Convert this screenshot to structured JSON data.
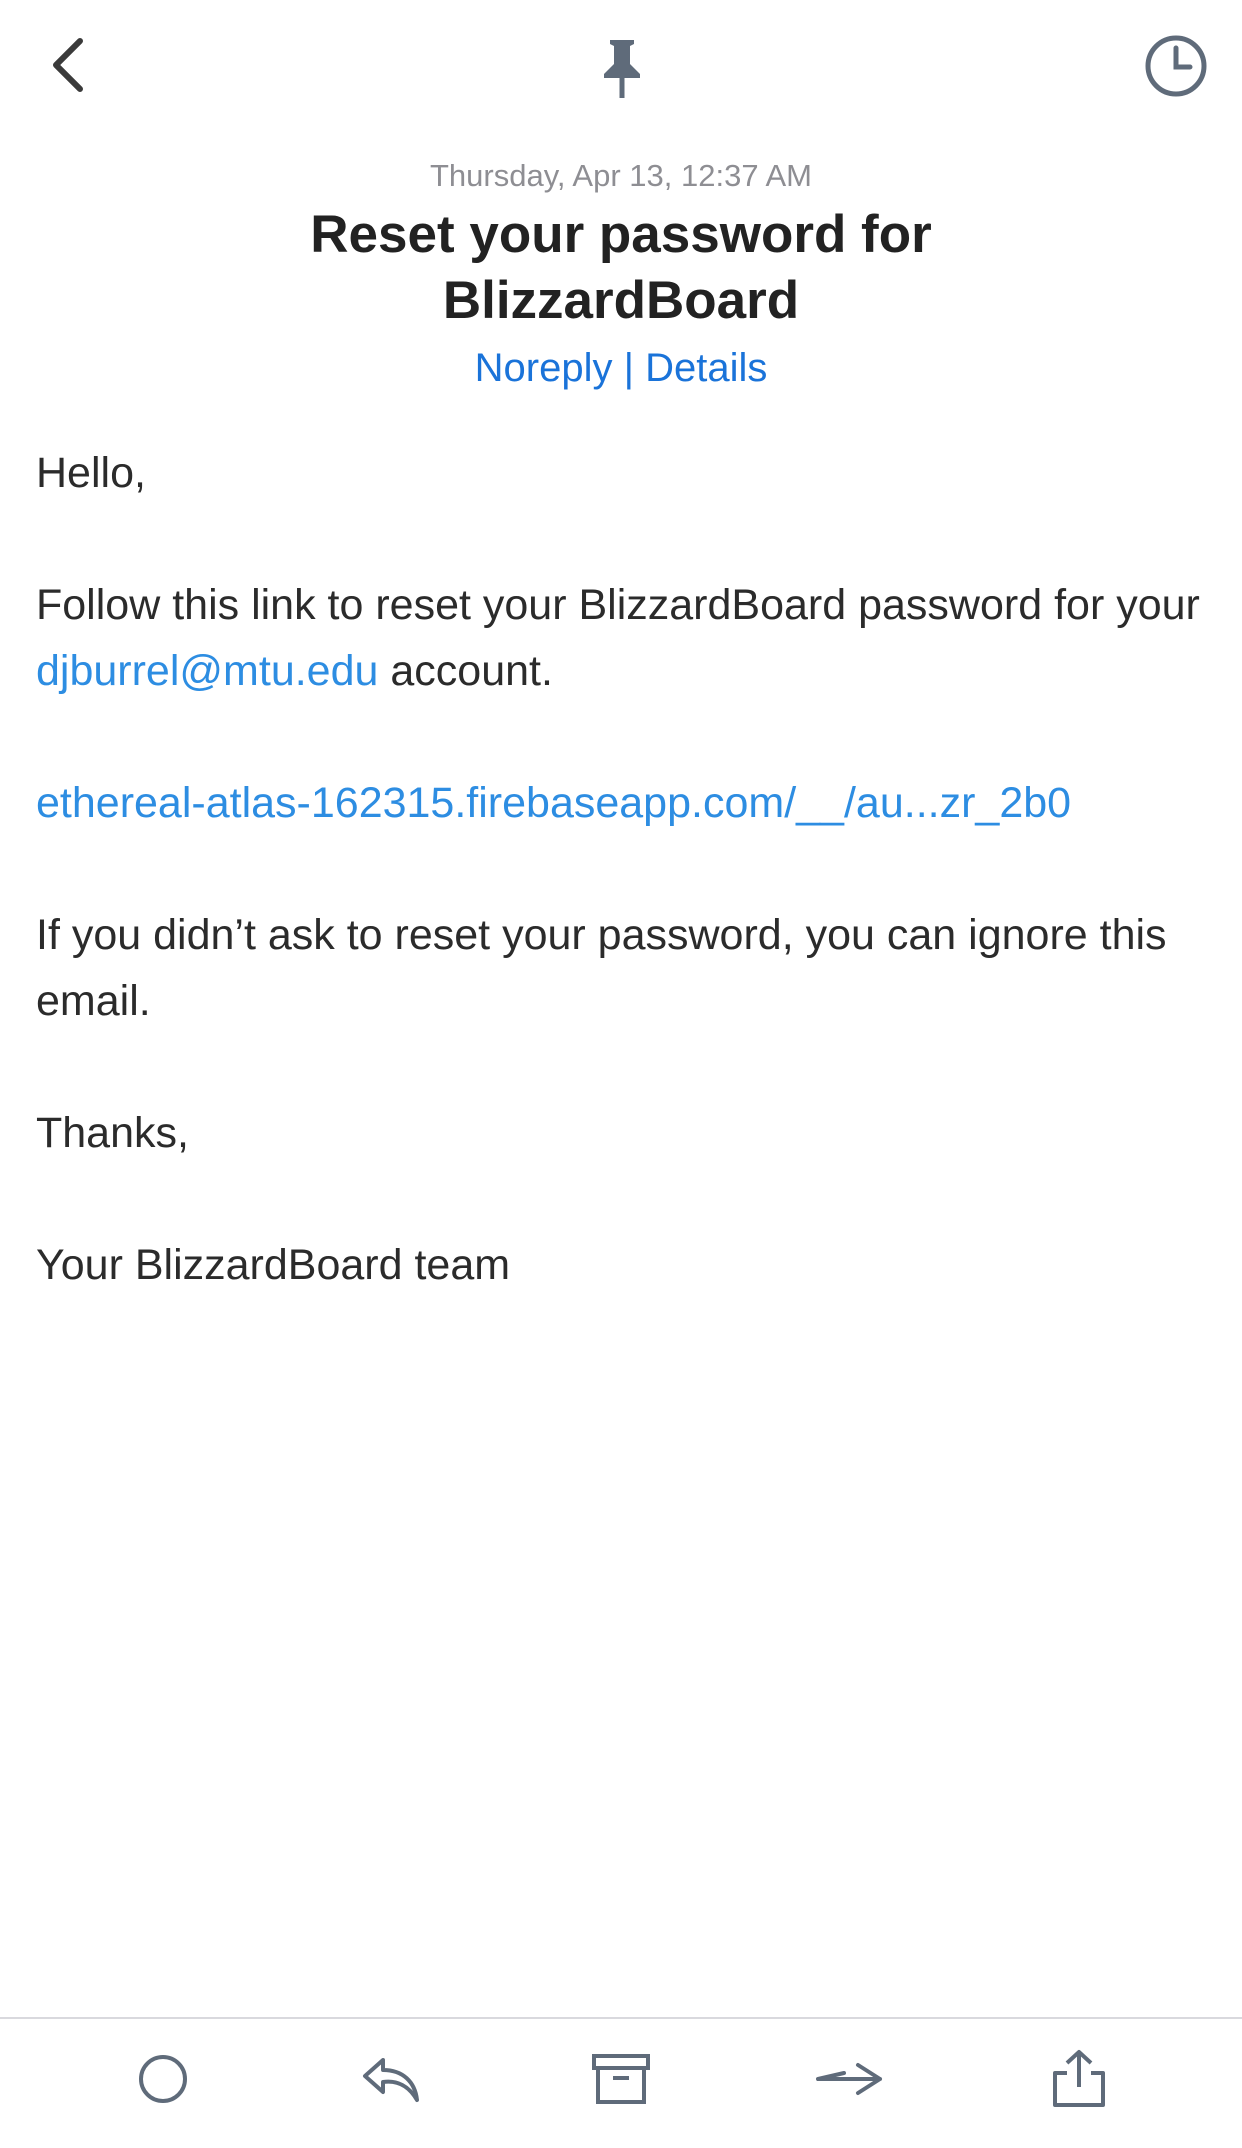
{
  "toolbar": {
    "back_icon": "chevron-left-icon",
    "pin_icon": "pin-icon",
    "snooze_icon": "clock-icon"
  },
  "email": {
    "date": "Thursday, Apr 13, 12:37 AM",
    "subject": "Reset your password for BlizzardBoard",
    "sender": "Noreply",
    "separator": "|",
    "details_label": "Details"
  },
  "body": {
    "greeting": "Hello,",
    "line1_prefix": "Follow this link to reset your BlizzardBoard password for your ",
    "email_link": "djburrel@mtu.edu",
    "line1_suffix": " account.",
    "reset_link": "ethereal-atlas-162315.firebaseapp.com/__/au...zr_2b0",
    "ignore_text": "If you didn’t ask to reset your password, you can ignore this email.",
    "thanks": "Thanks,",
    "signature": "Your BlizzardBoard team"
  },
  "bottom_bar": {
    "icons": [
      "circle-icon",
      "reply-icon",
      "archive-icon",
      "forward-icon",
      "share-icon"
    ]
  },
  "colors": {
    "accent": "#1a73d9",
    "link": "#2d8de2",
    "icon": "#5f6b7a",
    "date_gray": "#8e8e93"
  }
}
